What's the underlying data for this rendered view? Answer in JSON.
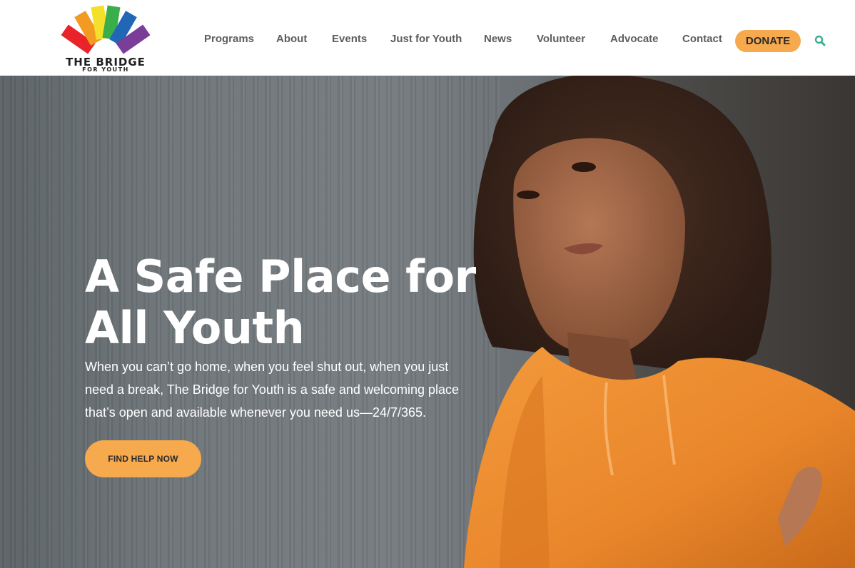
{
  "brand": {
    "name": "THE BRIDGE",
    "tagline": "FOR YOUTH",
    "logo_colors": [
      "#e8232a",
      "#f29a21",
      "#f4df2a",
      "#3aae49",
      "#2167b6",
      "#7a3d98"
    ]
  },
  "nav": {
    "items": [
      {
        "label": "Programs"
      },
      {
        "label": "About"
      },
      {
        "label": "Events"
      },
      {
        "label": "Just for Youth"
      },
      {
        "label": "News"
      },
      {
        "label": "Volunteer"
      },
      {
        "label": "Advocate"
      },
      {
        "label": "Contact"
      }
    ],
    "donate_label": "DONATE",
    "search_icon": "search-icon"
  },
  "hero": {
    "title_line1": "A Safe Place for",
    "title_line2": "All Youth",
    "text_line1": "When you can’t go home, when you feel shut out, when you just",
    "text_line2": "need a break, The Bridge for Youth is a safe and welcoming place",
    "text_line3": "that’s open and available whenever you need us—24/7/365.",
    "cta_label": "FIND HELP NOW"
  },
  "colors": {
    "accent": "#f6a94d",
    "search_icon": "#3aae8f",
    "nav_text": "#5b5e60"
  }
}
